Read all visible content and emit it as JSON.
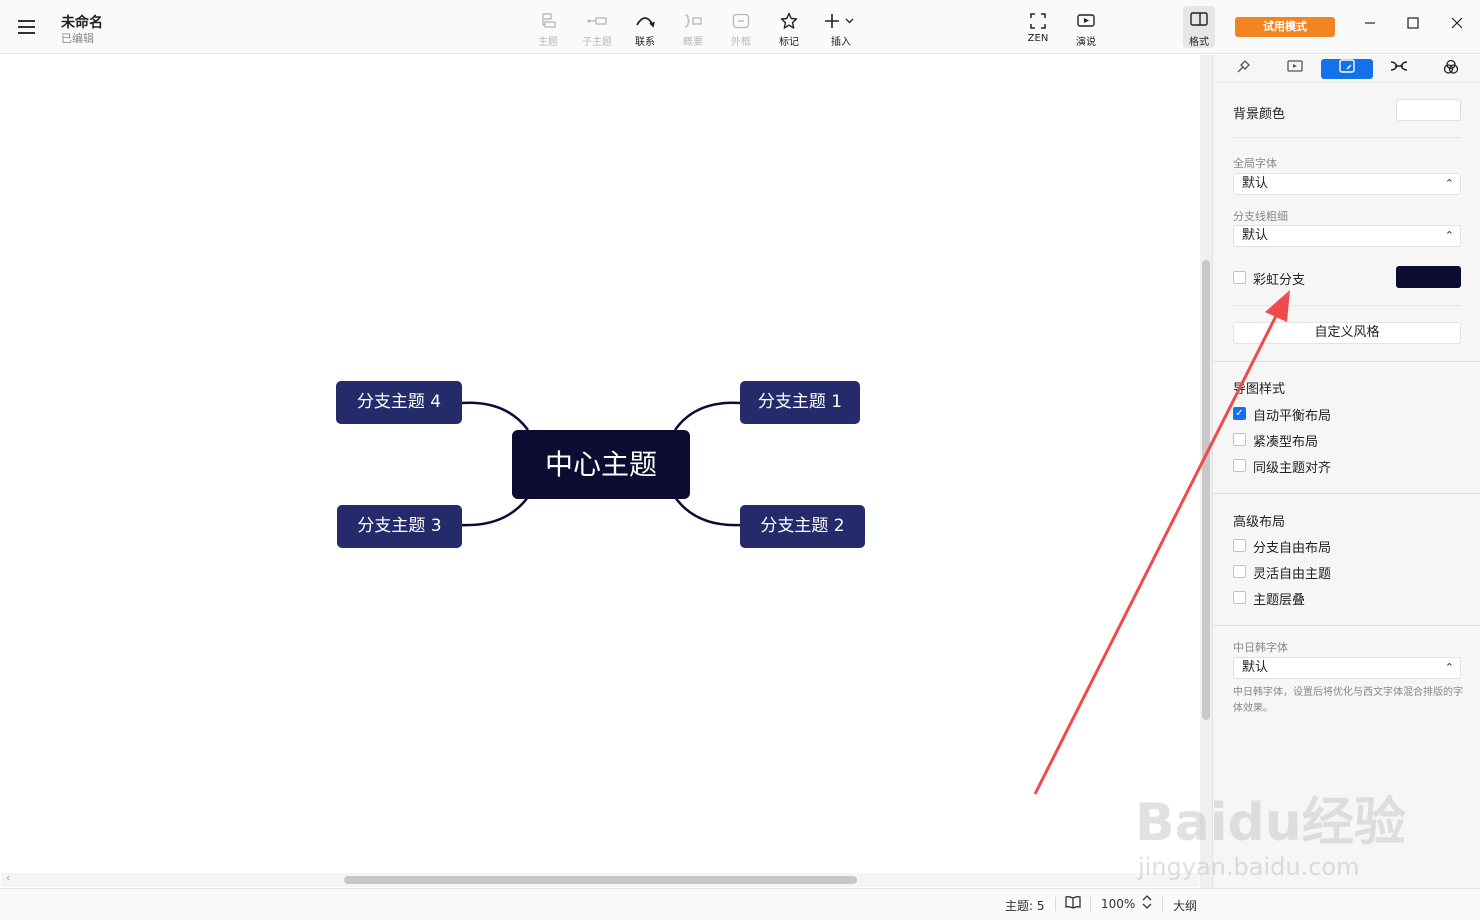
{
  "header": {
    "title": "未命名",
    "subtitle": "已编辑",
    "tools": [
      {
        "label": "主题",
        "icon": "topic-icon",
        "enabled": false
      },
      {
        "label": "子主题",
        "icon": "subtopic-icon",
        "enabled": false
      },
      {
        "label": "联系",
        "icon": "relationship-icon",
        "enabled": true
      },
      {
        "label": "概要",
        "icon": "summary-icon",
        "enabled": false
      },
      {
        "label": "外框",
        "icon": "boundary-icon",
        "enabled": false
      },
      {
        "label": "标记",
        "icon": "star-icon",
        "enabled": true
      },
      {
        "label": "插入",
        "icon": "plus-icon",
        "enabled": true
      }
    ],
    "zen_label": "ZEN",
    "present_label": "演说",
    "format_label": "格式",
    "trial_label": "试用模式"
  },
  "map": {
    "center": "中心主题",
    "branches": [
      "分支主题 1",
      "分支主题 2",
      "分支主题 3",
      "分支主题 4"
    ],
    "center_color": "#0c0c33",
    "branch_color": "#252a6b"
  },
  "panel": {
    "bg_color_label": "背景颜色",
    "global_font_label": "全局字体",
    "global_font_value": "默认",
    "branch_width_label": "分支线粗细",
    "branch_width_value": "默认",
    "rainbow_label": "彩虹分支",
    "rainbow_color": "#0c0c33",
    "custom_style_label": "自定义风格",
    "map_style_title": "导图样式",
    "map_style_options": [
      {
        "label": "自动平衡布局",
        "checked": true
      },
      {
        "label": "紧凑型布局",
        "checked": false
      },
      {
        "label": "同级主题对齐",
        "checked": false
      }
    ],
    "advanced_title": "高级布局",
    "advanced_options": [
      {
        "label": "分支自由布局",
        "checked": false
      },
      {
        "label": "灵活自由主题",
        "checked": false
      },
      {
        "label": "主题层叠",
        "checked": false
      }
    ],
    "cjk_font_label": "中日韩字体",
    "cjk_font_value": "默认",
    "cjk_help": "中日韩字体，设置后将优化与西文字体混合排版的字体效果。"
  },
  "status": {
    "topic_count": "主题: 5",
    "zoom": "100%",
    "outline_label": "大纲"
  },
  "watermark": {
    "text": "Baidu经验",
    "url": "jingyan.baidu.com"
  }
}
